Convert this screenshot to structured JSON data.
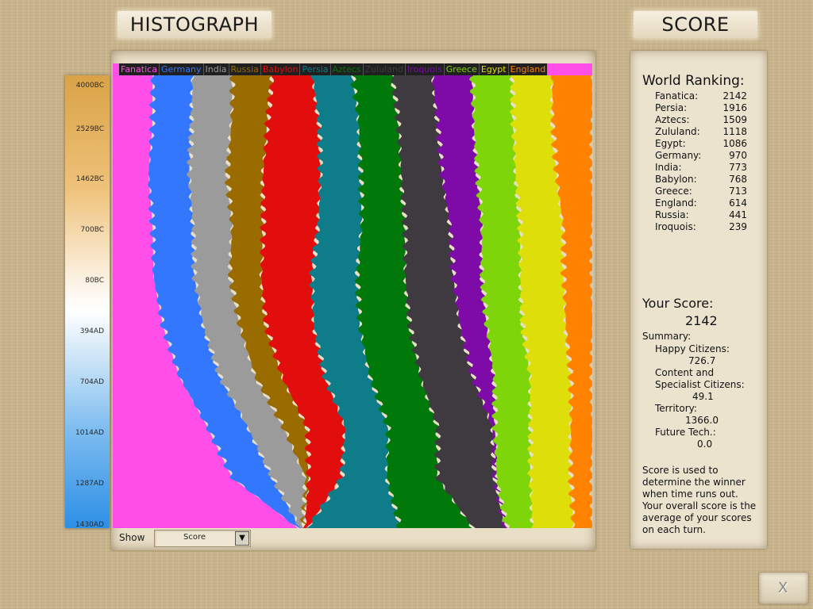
{
  "window": {
    "histograph_title": "HISTOGRAPH",
    "score_title": "SCORE"
  },
  "colors": {
    "Fanatica": "#ff4fe8",
    "Germany": "#3477ff",
    "India": "#9b9b9b",
    "Russia": "#9a6c00",
    "Babylon": "#e20e0e",
    "Persia": "#0f7c8a",
    "Aztecs": "#00780a",
    "Zululand": "#3f3a3f",
    "Iroquois": "#7e0aa8",
    "Greece": "#7ed60a",
    "Egypt": "#dede0a",
    "England": "#ff8200"
  },
  "timeline": {
    "ticks": [
      "4000BC",
      "2529BC",
      "1462BC",
      "700BC",
      "80BC",
      "394AD",
      "704AD",
      "1014AD",
      "1287AD",
      "1430AD"
    ]
  },
  "chart_data": {
    "type": "area",
    "stacking": "percent",
    "x": [
      "4000BC",
      "2529BC",
      "1462BC",
      "700BC",
      "80BC",
      "394AD",
      "704AD",
      "1014AD",
      "1287AD",
      "1430AD"
    ],
    "ylim": [
      0,
      100
    ],
    "series": [
      {
        "name": "Fanatica",
        "values": [
          8.3,
          8.3,
          7.5,
          8.3,
          8.5,
          10.5,
          14.0,
          20.0,
          25.0,
          39.0
        ]
      },
      {
        "name": "Germany",
        "values": [
          8.3,
          8.3,
          8.5,
          8.5,
          8.5,
          8.5,
          8.5,
          8.5,
          8.5,
          0.5
        ]
      },
      {
        "name": "India",
        "values": [
          8.3,
          8.3,
          8.0,
          8.0,
          7.5,
          7.5,
          7.5,
          7.5,
          7.0,
          0.5
        ]
      },
      {
        "name": "Russia",
        "values": [
          8.3,
          7.5,
          7.5,
          6.5,
          6.5,
          5.5,
          5.5,
          5.0,
          0.5,
          0.5
        ]
      },
      {
        "name": "Babylon",
        "values": [
          8.3,
          11.0,
          12.0,
          11.5,
          10.5,
          10.0,
          9.0,
          8.0,
          7.0,
          0.5
        ]
      },
      {
        "name": "Persia",
        "values": [
          8.3,
          8.3,
          8.5,
          9.0,
          9.5,
          9.5,
          9.5,
          9.0,
          9.5,
          19.5
        ]
      },
      {
        "name": "Aztecs",
        "values": [
          8.3,
          8.3,
          8.5,
          9.0,
          10.0,
          10.5,
          10.5,
          10.5,
          10.5,
          15.5
        ]
      },
      {
        "name": "Zululand",
        "values": [
          8.3,
          8.3,
          8.5,
          9.5,
          10.0,
          10.5,
          11.0,
          11.5,
          12.0,
          6.5
        ]
      },
      {
        "name": "Iroquois",
        "values": [
          8.3,
          7.5,
          7.5,
          6.5,
          6.0,
          5.5,
          4.5,
          0.5,
          0.5,
          0.5
        ]
      },
      {
        "name": "Greece",
        "values": [
          8.3,
          8.3,
          8.0,
          8.0,
          8.0,
          7.5,
          7.5,
          7.5,
          7.0,
          5.5
        ]
      },
      {
        "name": "Egypt",
        "values": [
          8.3,
          8.3,
          8.5,
          9.0,
          9.0,
          9.0,
          8.5,
          8.5,
          8.5,
          8.5
        ]
      },
      {
        "name": "England",
        "values": [
          8.3,
          8.3,
          7.5,
          6.0,
          6.0,
          5.5,
          4.5,
          4.5,
          4.5,
          4.0
        ]
      }
    ]
  },
  "show": {
    "label": "Show",
    "value": "Score"
  },
  "ranking": {
    "heading": "World Ranking:",
    "rows": [
      {
        "name": "Fanatica:",
        "score": "2142"
      },
      {
        "name": "Persia:",
        "score": "1916"
      },
      {
        "name": "Aztecs:",
        "score": "1509"
      },
      {
        "name": "Zululand:",
        "score": "1118"
      },
      {
        "name": "Egypt:",
        "score": "1086"
      },
      {
        "name": "Germany:",
        "score": "970"
      },
      {
        "name": "India:",
        "score": "773"
      },
      {
        "name": "Babylon:",
        "score": "768"
      },
      {
        "name": "Greece:",
        "score": "713"
      },
      {
        "name": "England:",
        "score": "614"
      },
      {
        "name": "Russia:",
        "score": "441"
      },
      {
        "name": "Iroquois:",
        "score": "239"
      }
    ]
  },
  "your_score": {
    "heading": "Your Score:",
    "value": "2142",
    "summary_label": "Summary:",
    "happy_label": "Happy Citizens:",
    "happy_value": "726.7",
    "content_label_1": "Content and",
    "content_label_2": "Specialist Citizens:",
    "content_value": "49.1",
    "territory_label": "Territory:",
    "territory_value": "1366.0",
    "future_label": "Future Tech.:",
    "future_value": "0.0",
    "note": "Score is used to determine the winner when time runs out. Your overall score is the average of your scores on each turn."
  },
  "close_button": {
    "label": "X"
  }
}
